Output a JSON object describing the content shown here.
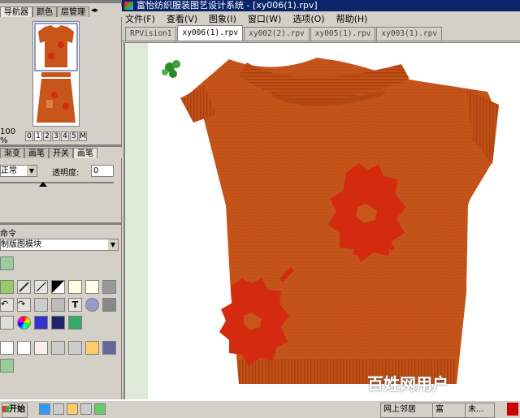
{
  "window": {
    "title": "富怡纺织服装图艺设计系统 - [xy006(1).rpv]"
  },
  "menu": [
    "文件(F)",
    "查看(V)",
    "图象(I)",
    "窗口(W)",
    "选项(O)",
    "帮助(H)"
  ],
  "doc_tabs": [
    {
      "label": "RPVision1",
      "active": false
    },
    {
      "label": "xy006(1).rpv",
      "active": true
    },
    {
      "label": "xy002(2).rpv",
      "active": false
    },
    {
      "label": "xy005(1).rpv",
      "active": false
    },
    {
      "label": "xy003(1).rpv",
      "active": false
    }
  ],
  "navigator": {
    "tabs": [
      "导航器",
      "颜色",
      "层管理"
    ],
    "zoom_label": "100 %",
    "zoom_buttons": [
      "0",
      "1",
      "2",
      "3",
      "4",
      "5",
      "M"
    ]
  },
  "brush_panel": {
    "tabs": [
      "渐变",
      "画笔",
      "开关",
      "画笔"
    ],
    "mode_value": "正常",
    "opacity_label": "透明度:",
    "opacity_value": "0"
  },
  "command_panel": {
    "title": "命令",
    "module_value": "制版图模块"
  },
  "taskbar": {
    "start_label": "开始",
    "items": [
      "网上邻居",
      "富",
      "未..."
    ]
  },
  "watermark": "百姓网用户",
  "colors": {
    "title_bg": "#0a246a",
    "sweater": "#c8561a",
    "sweater_dark": "#a8400f",
    "flower": "#d42a10"
  }
}
